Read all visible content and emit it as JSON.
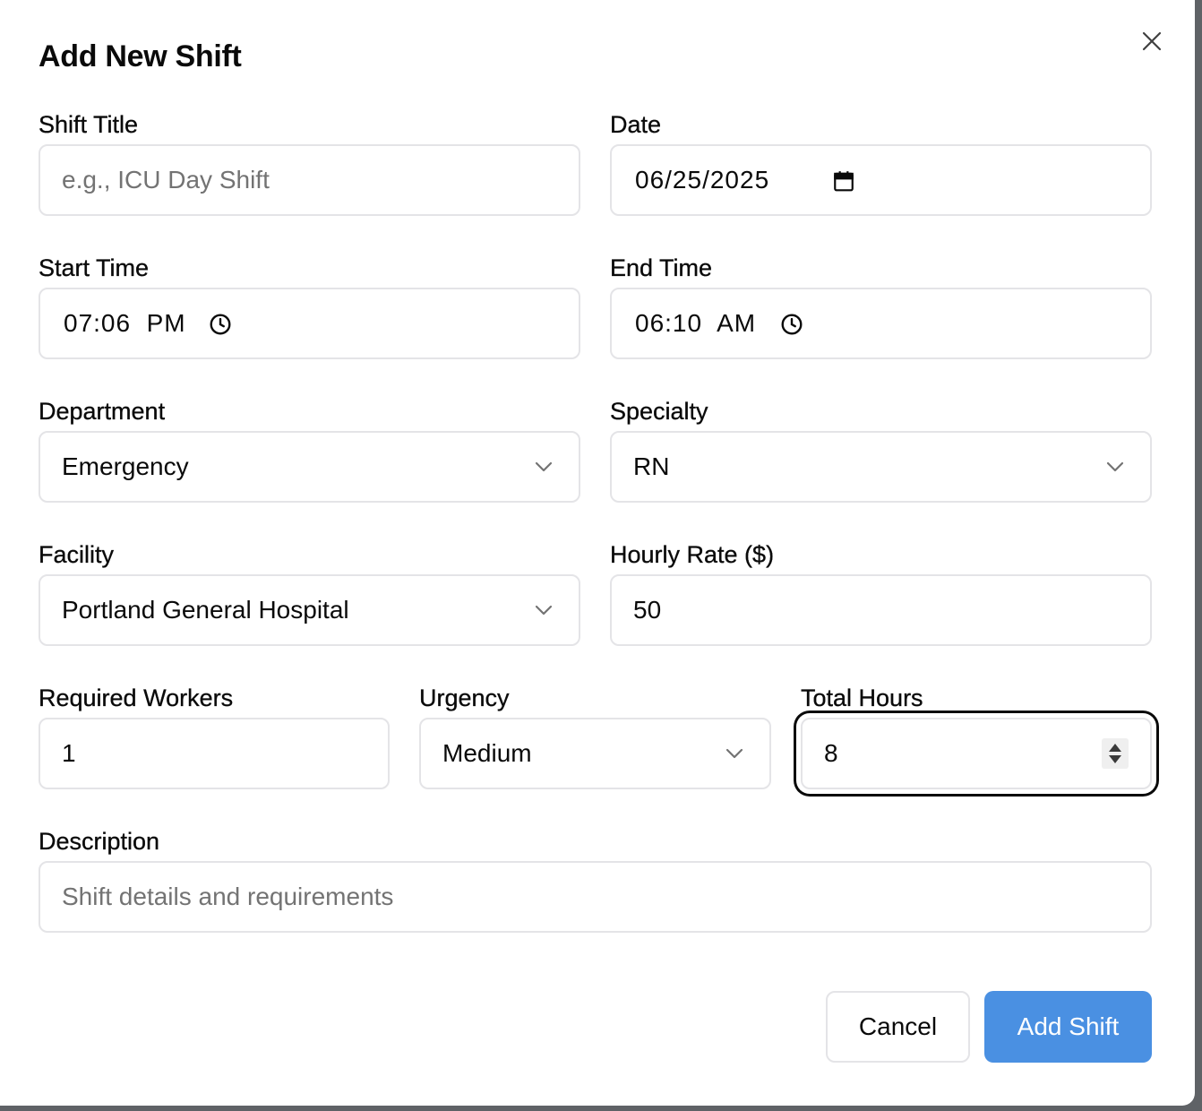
{
  "dialog": {
    "title": "Add New Shift",
    "close_icon": "close-icon"
  },
  "fields": {
    "shift_title": {
      "label": "Shift Title",
      "value": "",
      "placeholder": "e.g., ICU Day Shift"
    },
    "date": {
      "label": "Date",
      "value": "06/25/2025",
      "icon": "calendar-icon"
    },
    "start_time": {
      "label": "Start Time",
      "value": "07:06  PM",
      "icon": "clock-icon"
    },
    "end_time": {
      "label": "End Time",
      "value": "06:10  AM",
      "icon": "clock-icon"
    },
    "department": {
      "label": "Department",
      "value": "Emergency"
    },
    "specialty": {
      "label": "Specialty",
      "value": "RN"
    },
    "facility": {
      "label": "Facility",
      "value": "Portland General Hospital"
    },
    "hourly_rate": {
      "label": "Hourly Rate ($)",
      "value": "50"
    },
    "required_workers": {
      "label": "Required Workers",
      "value": "1"
    },
    "urgency": {
      "label": "Urgency",
      "value": "Medium"
    },
    "total_hours": {
      "label": "Total Hours",
      "value": "8",
      "focused": true
    },
    "description": {
      "label": "Description",
      "value": "",
      "placeholder": "Shift details and requirements"
    }
  },
  "actions": {
    "cancel_label": "Cancel",
    "submit_label": "Add Shift"
  },
  "colors": {
    "primary": "#4a90e2",
    "border": "#e4e4e7",
    "placeholder": "#737373",
    "text": "#0a0a0a"
  }
}
